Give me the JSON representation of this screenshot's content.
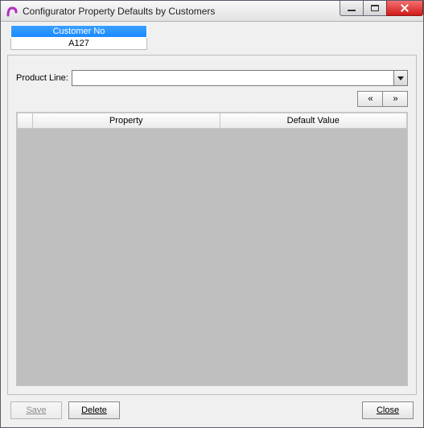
{
  "window": {
    "title": "Configurator Property Defaults by Customers"
  },
  "customer": {
    "header": "Customer No",
    "value": "A127"
  },
  "productLine": {
    "label": "Product Line:",
    "value": ""
  },
  "nav": {
    "prev": "‹‹",
    "next": "››"
  },
  "grid": {
    "columns": {
      "property": "Property",
      "defaultValue": "Default Value"
    },
    "rows": []
  },
  "buttons": {
    "save": "Save",
    "delete": "Delete",
    "close": "Close"
  }
}
